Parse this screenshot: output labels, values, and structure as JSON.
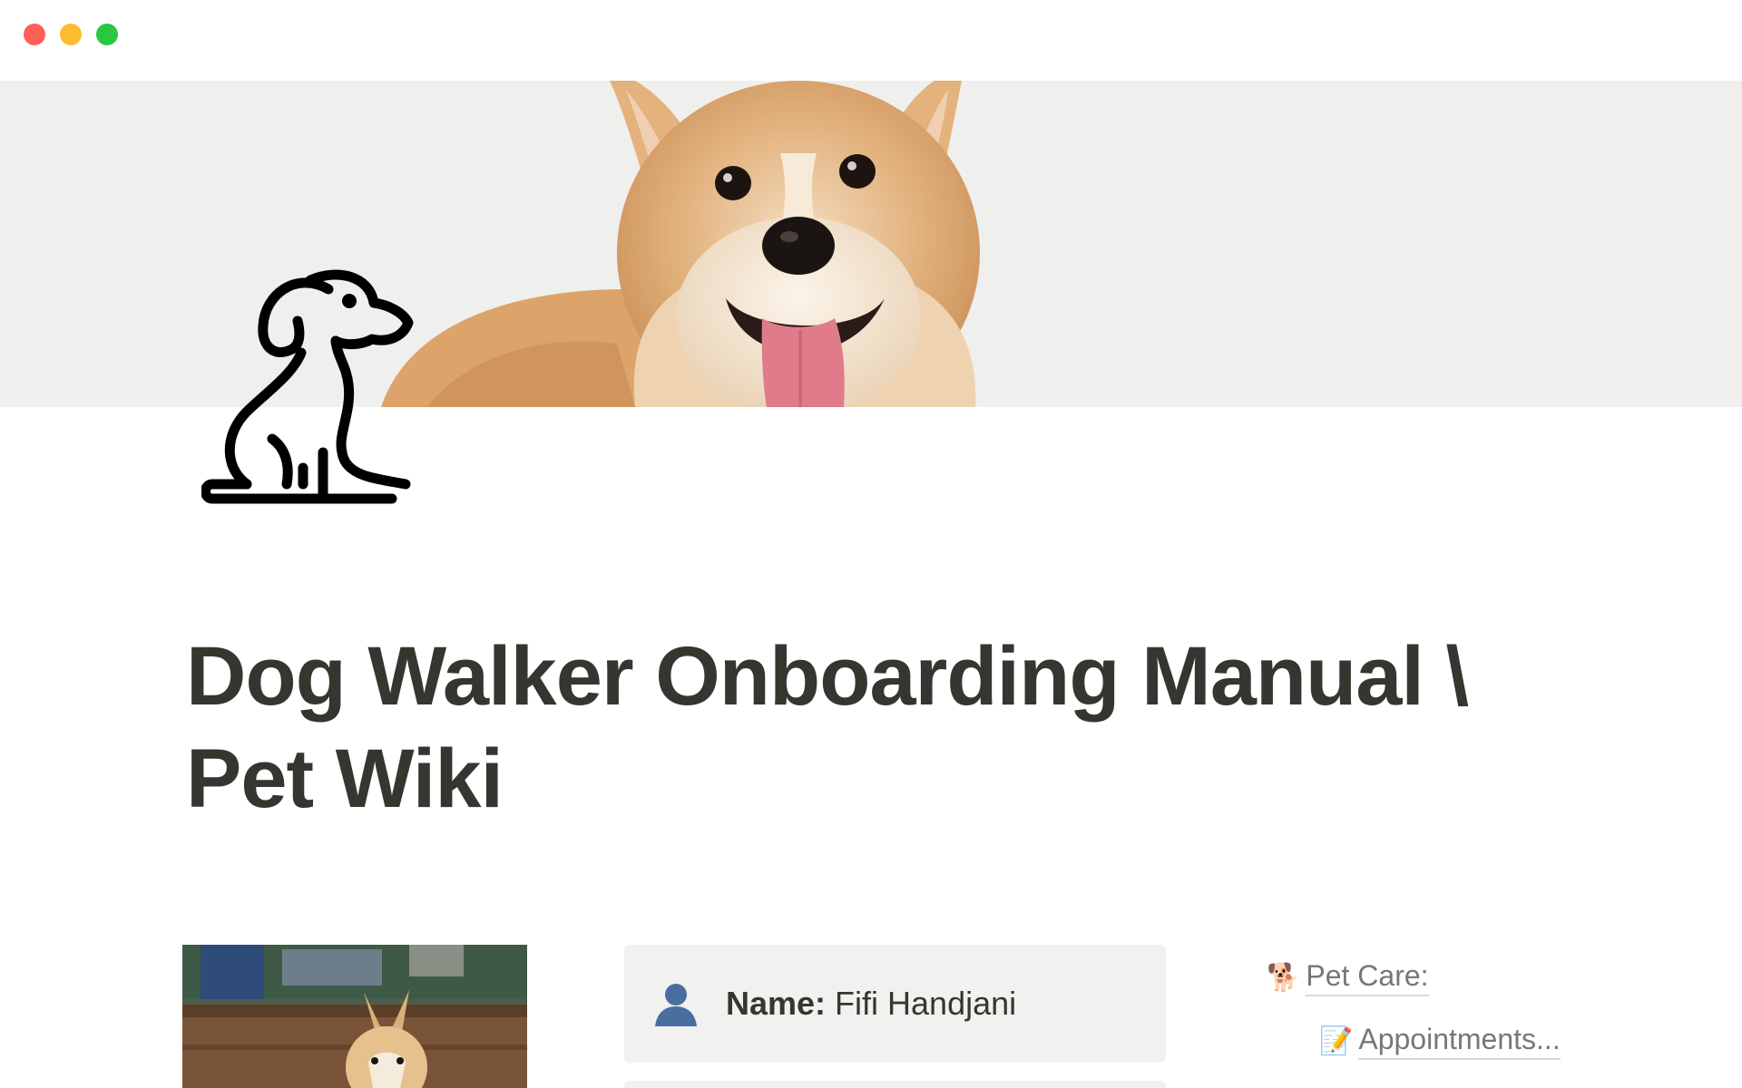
{
  "window": {
    "controls": [
      "close",
      "minimize",
      "maximize"
    ]
  },
  "cover": {
    "image": "corgi-photo",
    "background": "#efefee"
  },
  "page_icon": {
    "icon": "dog-icon"
  },
  "title": "Dog Walker Onboarding Manual \\ Pet Wiki",
  "pet_photo": {
    "image": "chihuahua-photo"
  },
  "callout": {
    "icon": "person-icon",
    "label": "Name:",
    "value": " Fifi Handjani"
  },
  "links": {
    "pet_care": {
      "emoji": "🐕",
      "label": "Pet Care:"
    },
    "appointments": {
      "emoji": "📝",
      "label": "Appointments..."
    }
  },
  "colors": {
    "text": "#37352f",
    "muted": "#787774",
    "callout_bg": "#f1f1ef",
    "close": "#ff5f57",
    "minimize": "#febc2e",
    "maximize": "#28c840"
  }
}
